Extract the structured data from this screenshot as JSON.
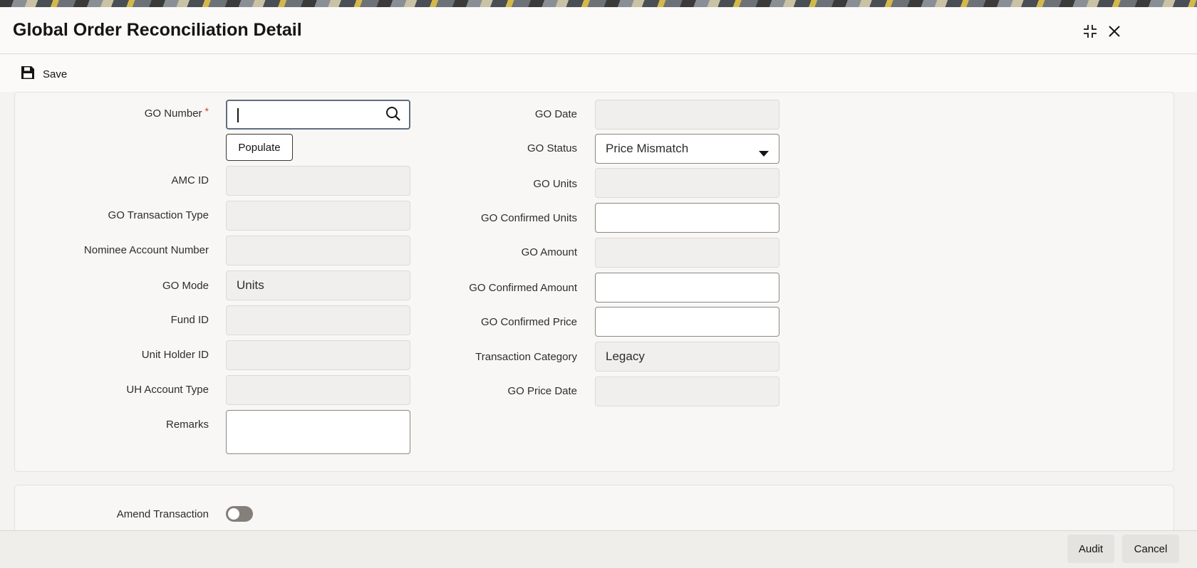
{
  "window": {
    "title": "Global Order Reconciliation Detail"
  },
  "header": {
    "icons": [
      "minimize-icon",
      "close-icon"
    ]
  },
  "toolbar": {
    "save_label": "Save",
    "save_icon": "floppy-disk-icon"
  },
  "form": {
    "go_number": {
      "label": "GO Number",
      "required_mark": "*",
      "value": "",
      "search_icon": "search-icon"
    },
    "populate_button": "Populate",
    "amc_id": {
      "label": "AMC ID",
      "value": ""
    },
    "go_transaction_type": {
      "label": "GO Transaction Type",
      "value": ""
    },
    "nominee_account_number": {
      "label": "Nominee Account Number",
      "value": ""
    },
    "go_mode": {
      "label": "GO Mode",
      "value": "Units"
    },
    "fund_id": {
      "label": "Fund ID",
      "value": ""
    },
    "unit_holder_id": {
      "label": "Unit Holder ID",
      "value": ""
    },
    "uh_account_type": {
      "label": "UH Account Type",
      "value": ""
    },
    "remarks": {
      "label": "Remarks",
      "value": ""
    },
    "go_date": {
      "label": "GO Date",
      "value": ""
    },
    "go_status": {
      "label": "GO Status",
      "value": "Price Mismatch"
    },
    "go_units": {
      "label": "GO Units",
      "value": ""
    },
    "go_confirmed_units": {
      "label": "GO Confirmed Units",
      "value": ""
    },
    "go_amount": {
      "label": "GO Amount",
      "value": ""
    },
    "go_confirmed_amount": {
      "label": "GO Confirmed Amount",
      "value": ""
    },
    "go_confirmed_price": {
      "label": "GO Confirmed Price",
      "value": ""
    },
    "transaction_category": {
      "label": "Transaction Category",
      "value": "Legacy"
    },
    "go_price_date": {
      "label": "GO Price Date",
      "value": ""
    }
  },
  "amend": {
    "label": "Amend Transaction",
    "enabled": false
  },
  "footer": {
    "audit_label": "Audit",
    "cancel_label": "Cancel"
  },
  "colors": {
    "required": "#c74634",
    "toggle_off": "#847f79"
  }
}
